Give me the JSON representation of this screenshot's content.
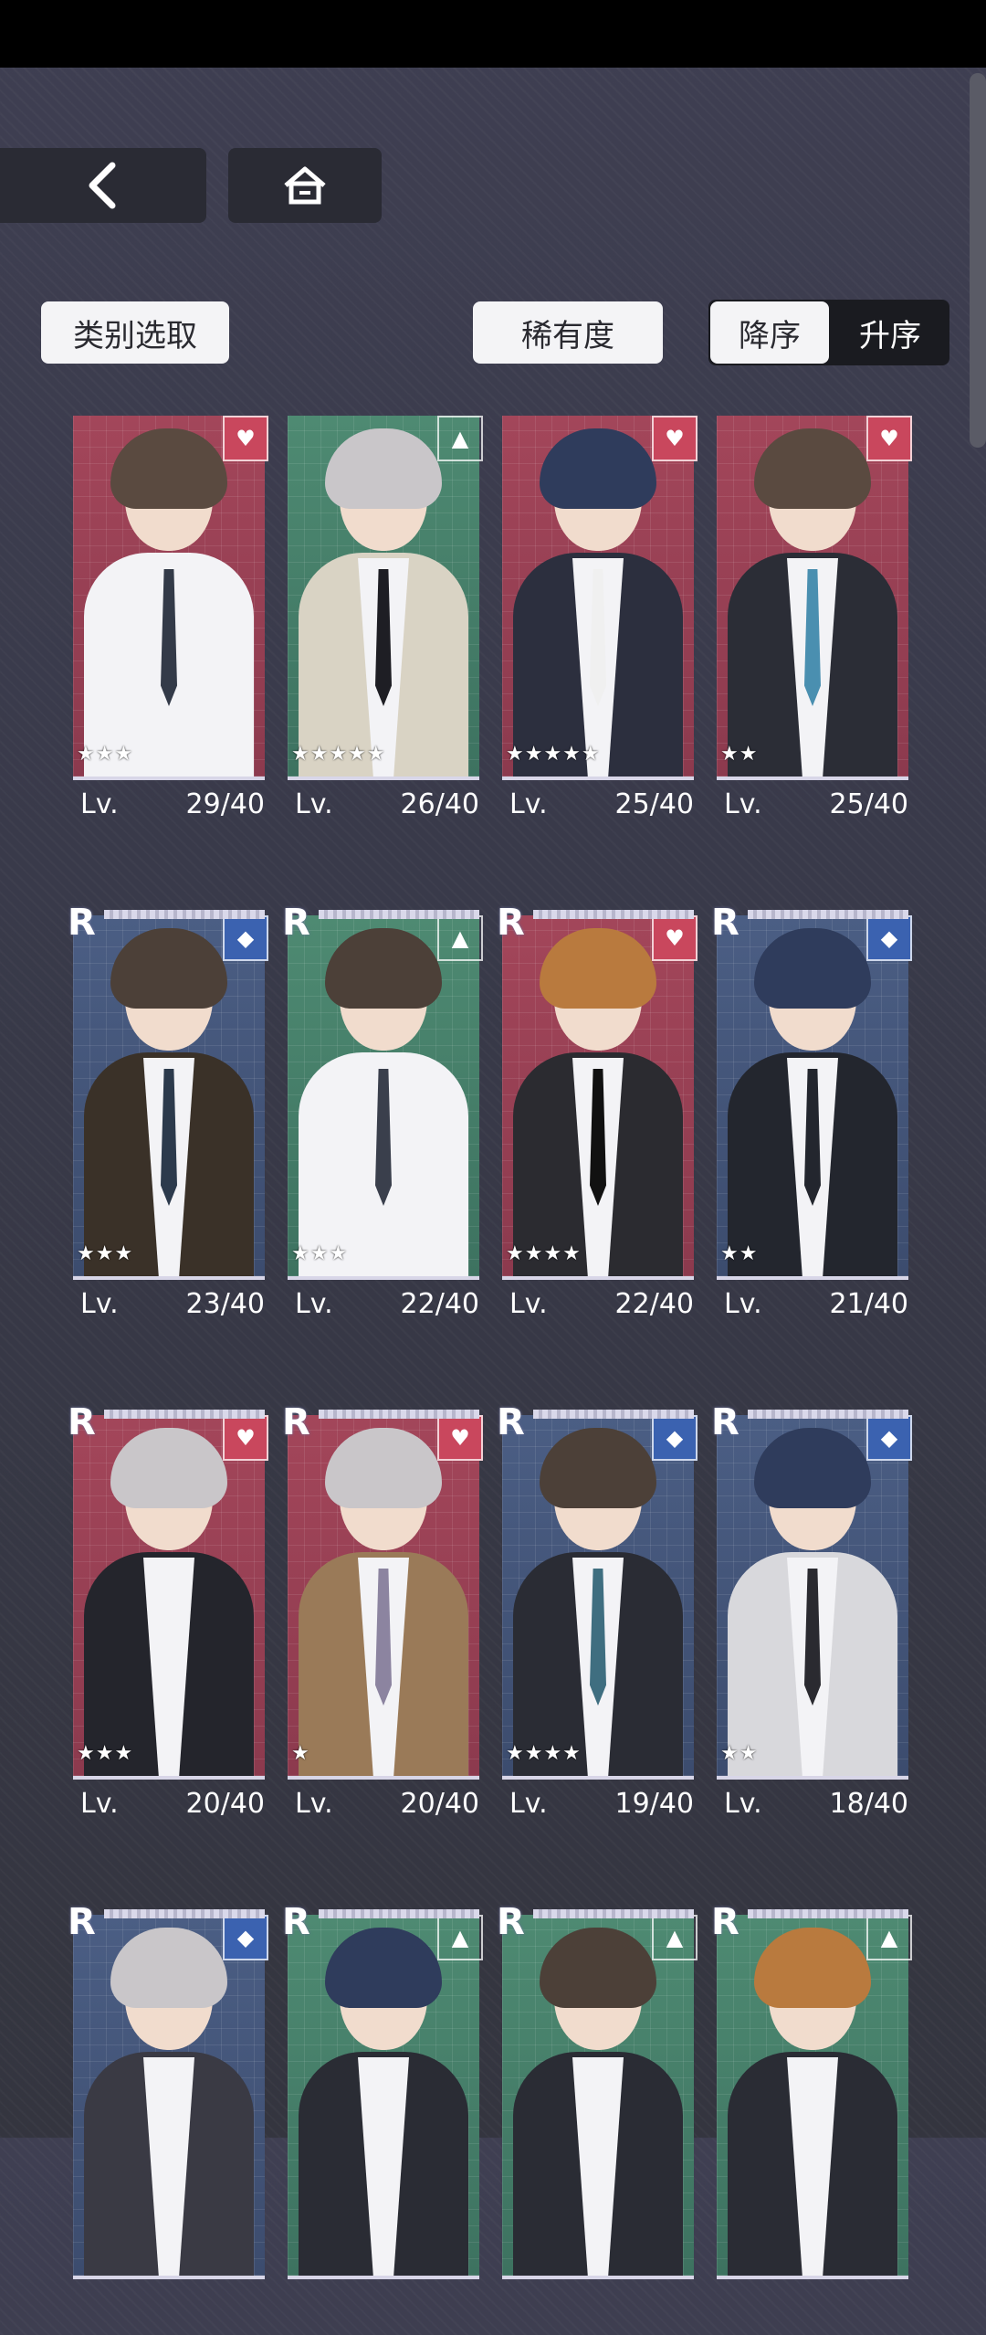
{
  "nav": {
    "back_icon": "chevron-left-icon",
    "home_icon": "home-icon"
  },
  "filters": {
    "category_label": "类别选取",
    "rarity_label": "稀有度",
    "sort_desc_label": "降序",
    "sort_asc_label": "升序",
    "selected_sort": "降序"
  },
  "colors": {
    "heart_attr": "#c9475d",
    "triangle_attr": "#3f9a7c",
    "diamond_attr": "#3b62b0"
  },
  "cards": [
    {
      "lv_label": "Lv.",
      "level": "29/40",
      "stars": "★★★",
      "attr": "heart",
      "bg": "red",
      "hair": "#5a4a40",
      "suit": "#f3f3f6",
      "tie": "#333a48",
      "rarity": ""
    },
    {
      "lv_label": "Lv.",
      "level": "26/40",
      "stars": "★★★★★",
      "attr": "triangle",
      "bg": "green",
      "hair": "#c9c6c9",
      "suit": "#d9d3c4",
      "tie": "#1e1e24",
      "rarity": ""
    },
    {
      "lv_label": "Lv.",
      "level": "25/40",
      "stars": "★★★★★",
      "attr": "heart",
      "bg": "red",
      "hair": "#2f3c5c",
      "suit": "#2c2f3e",
      "tie": "#f0f0f0",
      "rarity": ""
    },
    {
      "lv_label": "Lv.",
      "level": "25/40",
      "stars": "★★",
      "attr": "heart",
      "bg": "red",
      "hair": "#5a4a40",
      "suit": "#2b2d36",
      "tie": "#4a8fb0",
      "rarity": ""
    },
    {
      "lv_label": "Lv.",
      "level": "23/40",
      "stars": "★★★",
      "attr": "diamond",
      "bg": "blue",
      "hair": "#4c4038",
      "suit": "#3a3128",
      "tie": "#2c3a4c",
      "rarity": "R"
    },
    {
      "lv_label": "Lv.",
      "level": "22/40",
      "stars": "★★★",
      "attr": "triangle",
      "bg": "green",
      "hair": "#4c4038",
      "suit": "#f3f3f6",
      "tie": "#3a3f4c",
      "rarity": "R"
    },
    {
      "lv_label": "Lv.",
      "level": "22/40",
      "stars": "★★★★",
      "attr": "heart",
      "bg": "red",
      "hair": "#b97a3e",
      "suit": "#2b2b30",
      "tie": "#111111",
      "rarity": "R"
    },
    {
      "lv_label": "Lv.",
      "level": "21/40",
      "stars": "★★",
      "attr": "diamond",
      "bg": "blue",
      "hair": "#2f3c5c",
      "suit": "#23262e",
      "tie": "#23262e",
      "rarity": "R"
    },
    {
      "lv_label": "Lv.",
      "level": "20/40",
      "stars": "★★★",
      "attr": "heart",
      "bg": "red",
      "hair": "#c9c6c9",
      "suit": "#24252c",
      "tie": "#f3f3f6",
      "rarity": "R"
    },
    {
      "lv_label": "Lv.",
      "level": "20/40",
      "stars": "★",
      "attr": "heart",
      "bg": "red",
      "hair": "#c9c6c9",
      "suit": "#9a7a58",
      "tie": "#8c84a0",
      "rarity": "R"
    },
    {
      "lv_label": "Lv.",
      "level": "19/40",
      "stars": "★★★★",
      "attr": "diamond",
      "bg": "blue",
      "hair": "#4c4038",
      "suit": "#2a2c34",
      "tie": "#3f6e80",
      "rarity": "R"
    },
    {
      "lv_label": "Lv.",
      "level": "18/40",
      "stars": "★★",
      "attr": "diamond",
      "bg": "blue",
      "hair": "#2f3c5c",
      "suit": "#d8d8dc",
      "tie": "#2a2a30",
      "rarity": "R"
    },
    {
      "attr": "diamond",
      "bg": "blue",
      "hair": "#c9c6c9",
      "suit": "#3a3a44",
      "tie": "#f3f3f6",
      "rarity": "R"
    },
    {
      "attr": "triangle",
      "bg": "green",
      "hair": "#2f3c5c",
      "suit": "#2a2c34",
      "tie": "#f3f3f6",
      "rarity": "R"
    },
    {
      "attr": "triangle",
      "bg": "green",
      "hair": "#4c4038",
      "suit": "#2a2c34",
      "tie": "#f3f3f6",
      "rarity": "R"
    },
    {
      "attr": "triangle",
      "bg": "green",
      "hair": "#b97a3e",
      "suit": "#2a2c34",
      "tie": "#f3f3f6",
      "rarity": "R"
    }
  ]
}
